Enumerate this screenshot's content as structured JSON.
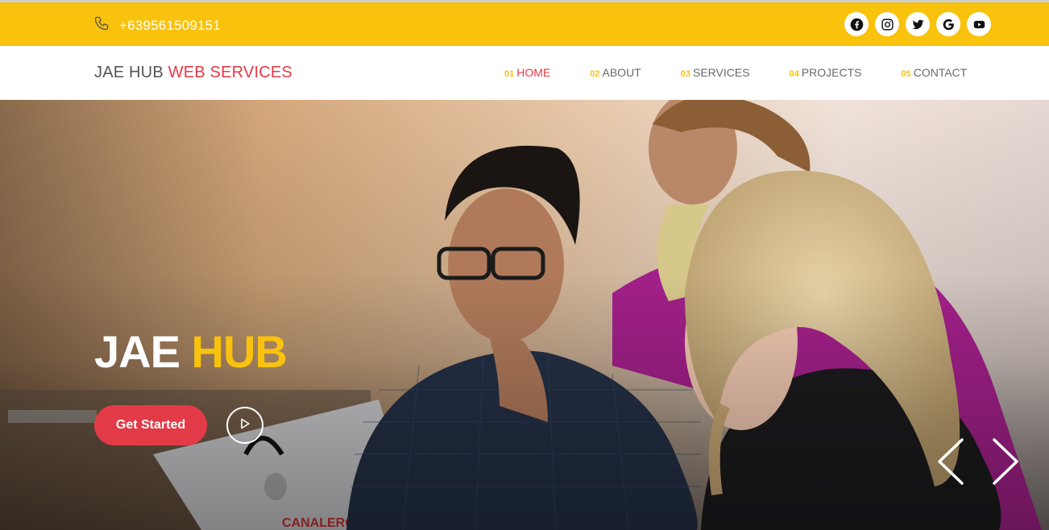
{
  "topbar": {
    "phone": "+639561509151",
    "background": "#f9c20d",
    "socials": [
      {
        "icon": "facebook-icon"
      },
      {
        "icon": "instagram-icon"
      },
      {
        "icon": "twitter-icon"
      },
      {
        "icon": "google-icon"
      },
      {
        "icon": "youtube-icon"
      }
    ]
  },
  "header": {
    "brand_main": "JAE HUB",
    "brand_accent": "WEB SERVICES",
    "nav": [
      {
        "num": "01",
        "label": "HOME",
        "active": true
      },
      {
        "num": "02",
        "label": "ABOUT"
      },
      {
        "num": "03",
        "label": "SERVICES"
      },
      {
        "num": "04",
        "label": "PROJECTS"
      },
      {
        "num": "05",
        "label": "CONTACT"
      }
    ]
  },
  "hero": {
    "title_white": "JAE",
    "title_yellow": "HUB",
    "cta_label": "Get Started",
    "image_alt": "photo of three people looking at a laptop"
  },
  "colors": {
    "accent_red": "#e23a46",
    "accent_yellow": "#f9c20d"
  }
}
